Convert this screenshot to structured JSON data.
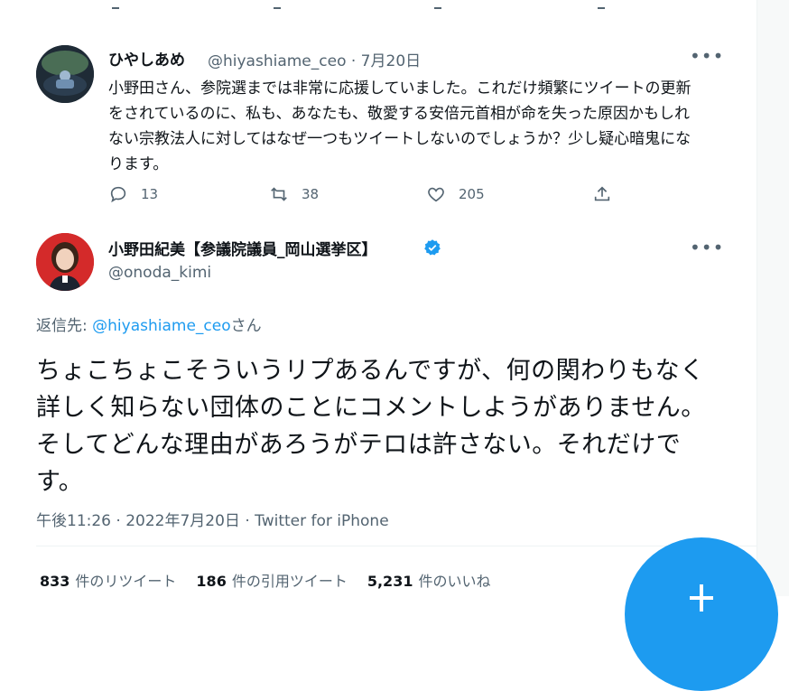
{
  "reply_tweet": {
    "display_name": "ひやしあめ",
    "handle_date": "@hiyashiame_ceo · 7月20日",
    "body": "小野田さん、参院選までは非常に応援していました。これだけ頻繁にツイートの更新をされているのに、私も、あなたも、敬愛する安倍元首相が命を失った原因かもしれない宗教法人に対してはなぜ一つもツイートしないのでしょうか？少し疑心暗鬼になります。",
    "more": "•••",
    "actions": {
      "reply_count": "13",
      "retweet_count": "38",
      "like_count": "205"
    }
  },
  "main_tweet": {
    "display_name": "小野田紀美【参議院議員_岡山選挙区】",
    "handle": "@onoda_kimi",
    "more": "•••",
    "reply_to_prefix": "返信先: ",
    "reply_to_handle": "@hiyashiame_ceo",
    "reply_to_suffix": "さん",
    "body": "ちょこちょこそういうリプあるんですが、何の関わりもなく詳しく知らない団体のことにコメントしようがありません。そしてどんな理由があろうがテロは許さない。それだけです。",
    "timestamp": "午後11:26 · 2022年7月20日 · Twitter for iPhone",
    "stats": {
      "retweets_count": "833",
      "retweets_label": "件のリツイート",
      "quotes_count": "186",
      "quotes_label": "件の引用ツイート",
      "likes_count": "5,231",
      "likes_label": "件のいいね"
    }
  },
  "colors": {
    "accent": "#1d9bf0",
    "text": "#0f1419",
    "secondary": "#536471"
  }
}
